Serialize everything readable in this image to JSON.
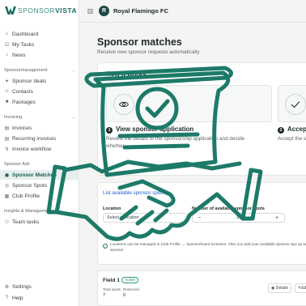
{
  "brand": {
    "logo_bold": "SPONSOR",
    "logo_accent": "VISTA",
    "color": "#1b6e60"
  },
  "topbar": {
    "club_initial": "R",
    "club_name": "Royal Flamingo FC"
  },
  "sidebar": {
    "items_top": [
      {
        "label": "Dashboard",
        "icon": "home-icon"
      },
      {
        "label": "My Tasks",
        "icon": "tasks-icon"
      },
      {
        "label": "News",
        "icon": "bell-icon"
      }
    ],
    "sections": [
      {
        "title": "Sponsormanagement",
        "items": [
          {
            "label": "Sponsor deals",
            "icon": "deal-icon"
          },
          {
            "label": "Contacts",
            "icon": "contacts-icon"
          },
          {
            "label": "Packages",
            "icon": "package-icon"
          }
        ]
      },
      {
        "title": "Invoicing",
        "items": [
          {
            "label": "Invoices",
            "icon": "invoice-icon"
          },
          {
            "label": "Recurring invoices",
            "icon": "recurring-icon"
          },
          {
            "label": "Invoice workflow",
            "icon": "workflow-icon"
          }
        ]
      },
      {
        "title": "Sponsor Ads",
        "items": [
          {
            "label": "Sponsor Matches",
            "icon": "matches-icon",
            "active": true
          },
          {
            "label": "Sponsor Spots",
            "icon": "spots-icon"
          },
          {
            "label": "Club Profile",
            "icon": "profile-icon"
          }
        ]
      },
      {
        "title": "Insights & Management",
        "items": [
          {
            "label": "Team tasks",
            "icon": "team-icon"
          }
        ]
      }
    ],
    "bottom": [
      {
        "label": "Settings",
        "icon": "gear-icon"
      },
      {
        "label": "Help",
        "icon": "help-icon"
      }
    ]
  },
  "main": {
    "title": "Sponsor matches",
    "subtitle": "Receive new sponsor requests automatically",
    "how": {
      "title": "How it works",
      "steps": [
        {
          "num": "1",
          "title": "View sponsor application",
          "desc": "Review the details of the sponsorship application and decide whether",
          "icon": "eye-icon"
        },
        {
          "num": "2",
          "title": "Accep",
          "desc": "Accept the sp",
          "icon": "check-icon"
        }
      ]
    },
    "spots": {
      "link": "List available sponsor spots",
      "location_label": "Location",
      "location_placeholder": "Select a location",
      "count_label": "Number of available sponsor spots",
      "count_value": "3",
      "info": "Locations can be managed in Club Profile → Sponsorboard locations. After you add your available sponsor spo up to sponsor"
    },
    "field": {
      "name": "Field 1",
      "badge": "Active",
      "total_label": "Total spots",
      "total_value": "7",
      "reserved_label": "Reserved",
      "reserved_value": "0",
      "details_label": "Details",
      "edit_label": "Ed"
    }
  },
  "overlay": {
    "color": "#1d7a69"
  }
}
